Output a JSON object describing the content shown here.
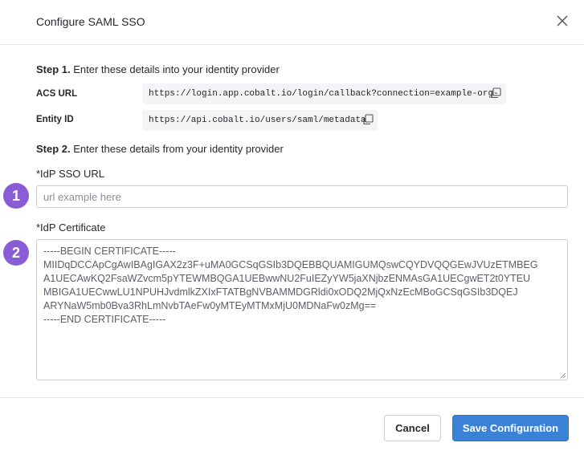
{
  "dialog": {
    "title": "Configure SAML SSO"
  },
  "step1": {
    "bold": "Step 1.",
    "text": "Enter these details into your identity provider",
    "acs_label": "ACS URL",
    "acs_value": "https://login.app.cobalt.io/login/callback?connection=example-org-",
    "entity_label": "Entity ID",
    "entity_value": "https://api.cobalt.io/users/saml/metadata"
  },
  "step2": {
    "bold": "Step 2.",
    "text": "Enter these details from your identity provider",
    "sso_url_label": "*IdP SSO URL",
    "sso_url_placeholder": "url example here",
    "sso_url_value": "",
    "cert_label": "*IdP Certificate",
    "cert_value": "-----BEGIN CERTIFICATE-----\nMIIDqDCCApCgAwIBAgIGAX2z3F+uMA0GCSqGSIb3DQEBBQUAMIGUMQswCQYDVQQGEwJVUzETMBEG\nA1UECAwKQ2FsaWZvcm5pYTEWMBQGA1UEBwwNU2FuIEZyYW5jaXNjbzENMAsGA1UECgwET2t0YTEU\nMBIGA1UECwwLU1NPUHJvdmlkZXIxFTATBgNVBAMMDGRldi0xODQ2MjQxNzEcMBoGCSqGSIb3DQEJ\nARYNaW5mb0Bva3RhLmNvbTAeFw0yMTEyMTMxMjU0MDNaFw0zMg==\n-----END CERTIFICATE-----"
  },
  "badges": [
    "1",
    "2"
  ],
  "buttons": {
    "cancel": "Cancel",
    "save": "Save Configuration"
  },
  "colors": {
    "accent": "#3b82d6",
    "badge": "#8a5cd6"
  },
  "icons": {
    "close": "close-icon",
    "copy": "copy-icon"
  }
}
